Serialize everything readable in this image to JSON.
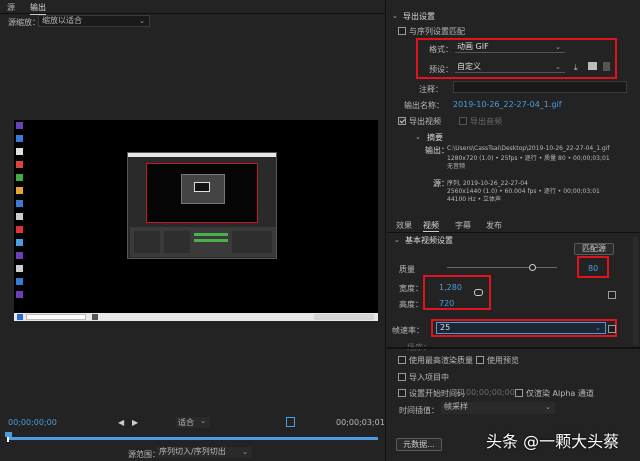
{
  "left_tabs": [
    "源",
    "输出"
  ],
  "source_scaling": {
    "label": "源缩放：",
    "value": "缩放以适合"
  },
  "desktop_icons": 14,
  "player": {
    "time_start": "00;00;00;00",
    "fit": "适合",
    "time_end": "00;00;03;01"
  },
  "range": {
    "label": "源范围：",
    "value": "序列切入/序列切出"
  },
  "export_settings": {
    "header": "导出设置",
    "match_sequence": "与序列设置匹配",
    "format_label": "格式：",
    "format_value": "动画 GIF",
    "preset_label": "预设：",
    "preset_value": "自定义",
    "comment_label": "注释：",
    "output_name_label": "输出名称：",
    "output_name_value": "2019-10-26_22-27-04_1.gif",
    "export_video": "导出视频",
    "export_audio": "导出音频"
  },
  "summary": {
    "header": "摘要",
    "output_label": "输出：",
    "output_lines": [
      "C:\\Users\\CassTsai\\Desktop\\2019-10-26_22-27-04_1.gif",
      "1280x720 (1.0) • 25fps • 逐行 • 质量 80 • 00;00;03;01",
      "无音频"
    ],
    "source_label": "源：",
    "source_lines": [
      "序列, 2019-10-26_22-27-04",
      "2560x1440 (1.0) • 60.004 fps • 逐行 • 00;00;03;01",
      "44100 Hz • 立体声"
    ]
  },
  "right_tabs": [
    "效果",
    "视频",
    "字幕",
    "发布"
  ],
  "video": {
    "header": "基本视频设置",
    "match_source": "匹配源",
    "quality_label": "质量",
    "quality_value": "80",
    "quality_fraction": 0.8,
    "width_label": "宽度：",
    "width_value": "1,280",
    "height_label": "高度：",
    "height_value": "720",
    "fps_label": "帧速率：",
    "fps_value": "25",
    "field_label": "场序："
  },
  "options": {
    "max_quality": "使用最高渲染质量",
    "use_preview": "使用预览",
    "import_project": "导入项目中",
    "set_timecode": "设置开始时间码",
    "timecode_value": "00;00;00;00",
    "render_alpha": "仅渲染 Alpha 通道",
    "interp_label": "时间插值：",
    "interp_value": "帧采样"
  },
  "metadata_button": "元数据...",
  "watermark": "头条 @一颗大头蔡",
  "colors": {
    "accent": "#4a9ce3",
    "highlight": "#e0141e"
  }
}
